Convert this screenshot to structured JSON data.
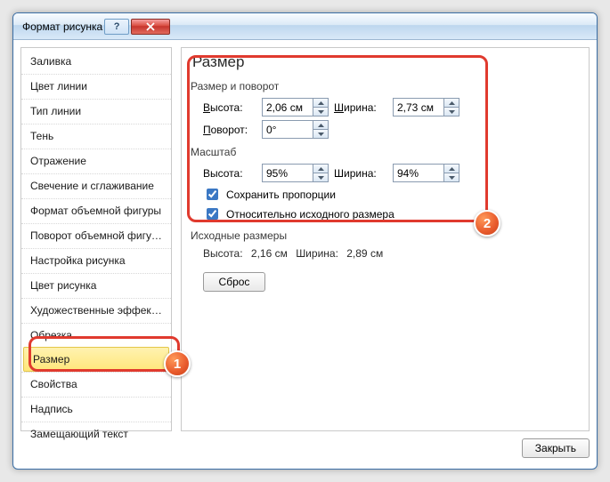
{
  "window": {
    "title": "Формат рисунка"
  },
  "sidebar": {
    "items": [
      {
        "label": "Заливка"
      },
      {
        "label": "Цвет линии"
      },
      {
        "label": "Тип линии"
      },
      {
        "label": "Тень"
      },
      {
        "label": "Отражение"
      },
      {
        "label": "Свечение и сглаживание"
      },
      {
        "label": "Формат объемной фигуры"
      },
      {
        "label": "Поворот объемной фигуры"
      },
      {
        "label": "Настройка рисунка"
      },
      {
        "label": "Цвет рисунка"
      },
      {
        "label": "Художественные эффекты"
      },
      {
        "label": "Обрезка"
      },
      {
        "label": "Размер",
        "selected": true
      },
      {
        "label": "Свойства"
      },
      {
        "label": "Надпись"
      },
      {
        "label": "Замещающий текст"
      }
    ]
  },
  "page": {
    "heading": "Размер",
    "group_rotate": {
      "title": "Размер и поворот",
      "height_label": "Высота:",
      "height_value": "2,06 см",
      "width_label": "Ширина:",
      "width_value": "2,73 см",
      "rotate_label": "Поворот:",
      "rotate_value": "0°"
    },
    "group_scale": {
      "title": "Масштаб",
      "height_label": "Высота:",
      "height_value": "95%",
      "width_label": "Ширина:",
      "width_value": "94%",
      "lock_aspect": "Сохранить пропорции",
      "relative_original": "Относительно исходного размера"
    },
    "group_original": {
      "title": "Исходные размеры",
      "height_label": "Высота:",
      "height_value": "2,16 см",
      "width_label": "Ширина:",
      "width_value": "2,89 см",
      "reset_label": "Сброс"
    }
  },
  "footer": {
    "close_label": "Закрыть"
  },
  "annotations": {
    "badge1": "1",
    "badge2": "2"
  }
}
